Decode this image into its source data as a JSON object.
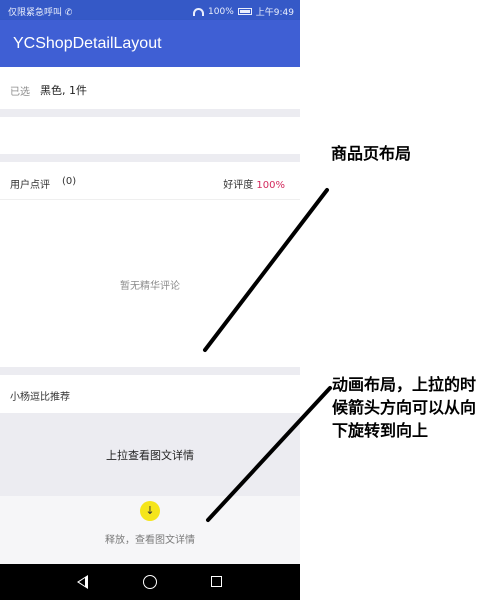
{
  "status_bar": {
    "carrier": "仅限紧急呼叫 ✆",
    "battery": "100%",
    "time": "上午9:49"
  },
  "app_bar": {
    "title": "YCShopDetailLayout"
  },
  "selection": {
    "label": "已选",
    "value": "黑色, 1件"
  },
  "reviews": {
    "label": "用户点评",
    "count": "(0)",
    "rating_label": "好评度",
    "rating_value": "100%",
    "empty_text": "暂无精华评论"
  },
  "recommend": {
    "label": "小杨逗比推荐"
  },
  "pull_panel": {
    "text": "上拉查看图文详情"
  },
  "release_panel": {
    "arrow": "↓",
    "text": "释放，查看图文详情"
  },
  "annotations": {
    "page_layout": "商品页布局",
    "animation_layout": "动画布局，上拉的时候箭头方向可以从向下旋转到向上"
  },
  "colors": {
    "status_bar": "#3559c7",
    "app_bar": "#3f5fd4",
    "rating_accent": "#d32a5d",
    "arrow_button": "#f5e51a"
  }
}
